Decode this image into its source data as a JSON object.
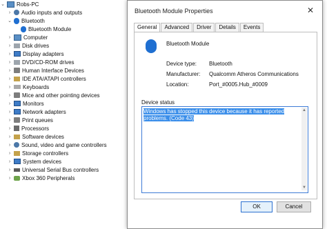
{
  "tree": {
    "root": "Robs-PC",
    "items": [
      {
        "label": "Audio inputs and outputs",
        "icon": "audio-icon"
      },
      {
        "label": "Bluetooth",
        "icon": "bluetooth-icon"
      },
      {
        "label": "Bluetooth Module",
        "icon": "bluetooth-icon"
      },
      {
        "label": "Computer",
        "icon": "computer-icon"
      },
      {
        "label": "Disk drives",
        "icon": "disk-icon"
      },
      {
        "label": "Display adapters",
        "icon": "display-icon"
      },
      {
        "label": "DVD/CD-ROM drives",
        "icon": "dvd-icon"
      },
      {
        "label": "Human Interface Devices",
        "icon": "hid-icon"
      },
      {
        "label": "IDE ATA/ATAPI controllers",
        "icon": "ide-icon"
      },
      {
        "label": "Keyboards",
        "icon": "keyboard-icon"
      },
      {
        "label": "Mice and other pointing devices",
        "icon": "mouse-icon"
      },
      {
        "label": "Monitors",
        "icon": "monitor-icon"
      },
      {
        "label": "Network adapters",
        "icon": "network-icon"
      },
      {
        "label": "Print queues",
        "icon": "printer-icon"
      },
      {
        "label": "Processors",
        "icon": "processor-icon"
      },
      {
        "label": "Software devices",
        "icon": "software-icon"
      },
      {
        "label": "Sound, video and game controllers",
        "icon": "sound-icon"
      },
      {
        "label": "Storage controllers",
        "icon": "storage-icon"
      },
      {
        "label": "System devices",
        "icon": "system-icon"
      },
      {
        "label": "Universal Serial Bus controllers",
        "icon": "usb-icon"
      },
      {
        "label": "Xbox 360 Peripherals",
        "icon": "xbox-icon"
      }
    ]
  },
  "dialog": {
    "title": "Bluetooth Module Properties",
    "close": "✕",
    "tabs": [
      "General",
      "Advanced",
      "Driver",
      "Details",
      "Events"
    ],
    "active_tab": "General",
    "device_name": "Bluetooth Module",
    "props": {
      "type_label": "Device type:",
      "type_value": "Bluetooth",
      "mfr_label": "Manufacturer:",
      "mfr_value": "Qualcomm Atheros Communications",
      "loc_label": "Location:",
      "loc_value": "Port_#0005.Hub_#0009"
    },
    "status_label": "Device status",
    "status_line1": "Windows has stopped this device because it has reported",
    "status_line2": "problems. (Code 43)",
    "ok": "OK",
    "cancel": "Cancel"
  }
}
